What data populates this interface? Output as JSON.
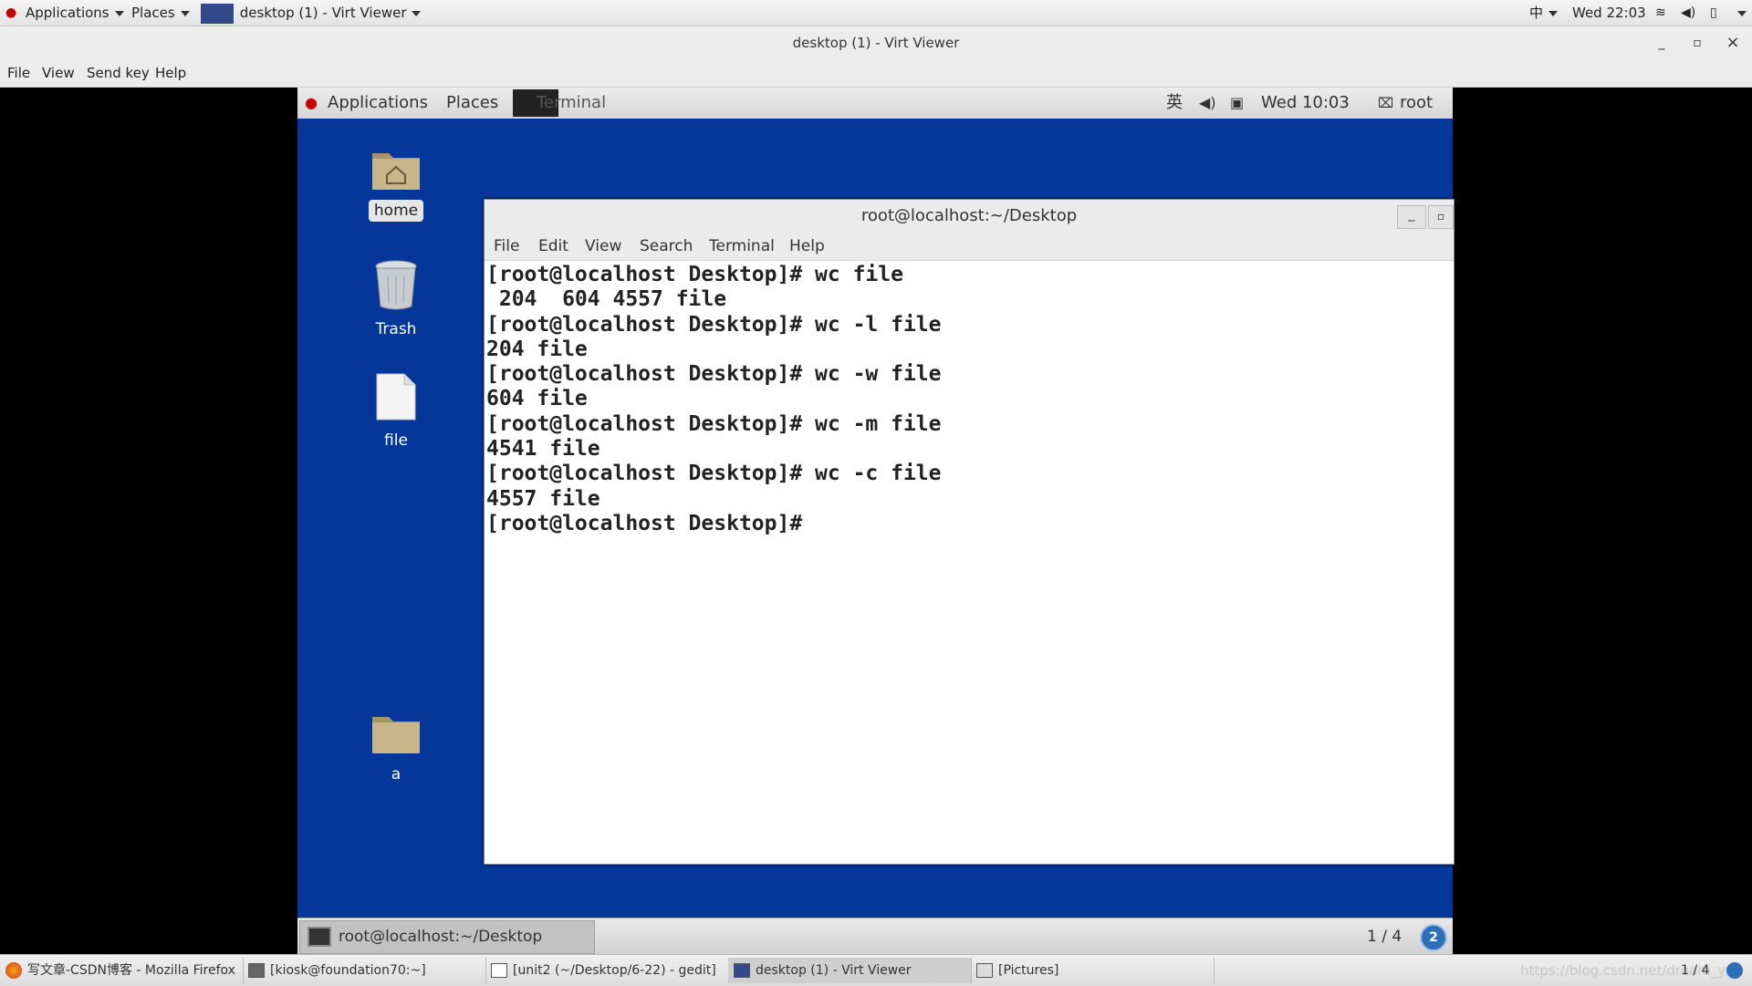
{
  "host_panel": {
    "applications": "Applications",
    "places": "Places",
    "window_title": "desktop (1) - Virt Viewer",
    "input_method": "中",
    "clock": "Wed 22:03"
  },
  "window": {
    "title": "desktop (1) - Virt Viewer",
    "minimize": "_",
    "maximize": "▫",
    "close": "×"
  },
  "viewer_menu": [
    "File",
    "View",
    "Send key",
    "Help"
  ],
  "guest_panel": {
    "applications": "Applications",
    "places": "Places",
    "terminal": "Terminal",
    "input_method": "英",
    "clock": "Wed 10:03",
    "user": "root"
  },
  "desktop_icons": [
    {
      "label": "home",
      "icon": "folder-home-icon"
    },
    {
      "label": "Trash",
      "icon": "trash-icon"
    },
    {
      "label": "file",
      "icon": "file-icon"
    },
    {
      "label": "a",
      "icon": "folder-icon"
    }
  ],
  "terminal": {
    "title": "root@localhost:~/Desktop",
    "menu": [
      "File",
      "Edit",
      "View",
      "Search",
      "Terminal",
      "Help"
    ],
    "lines": [
      "[root@localhost Desktop]# wc file",
      " 204  604 4557 file",
      "[root@localhost Desktop]# wc -l file",
      "204 file",
      "[root@localhost Desktop]# wc -w file",
      "604 file",
      "[root@localhost Desktop]# wc -m file",
      "4541 file",
      "[root@localhost Desktop]# wc -c file",
      "4557 file",
      "[root@localhost Desktop]# "
    ]
  },
  "guest_bottom": {
    "task_label": "root@localhost:~/Desktop",
    "workspace": "1 / 4",
    "notification_count": "2"
  },
  "host_taskbar": {
    "tasks": [
      "写文章-CSDN博客 - Mozilla Firefox",
      "[kiosk@foundation70:~]",
      "[unit2 (~/Desktop/6-22) - gedit]",
      "desktop (1) - Virt Viewer",
      "[Pictures]"
    ],
    "watermark": "https://blog.csdn.net/dream_ya",
    "workspace": "1 / 4"
  }
}
